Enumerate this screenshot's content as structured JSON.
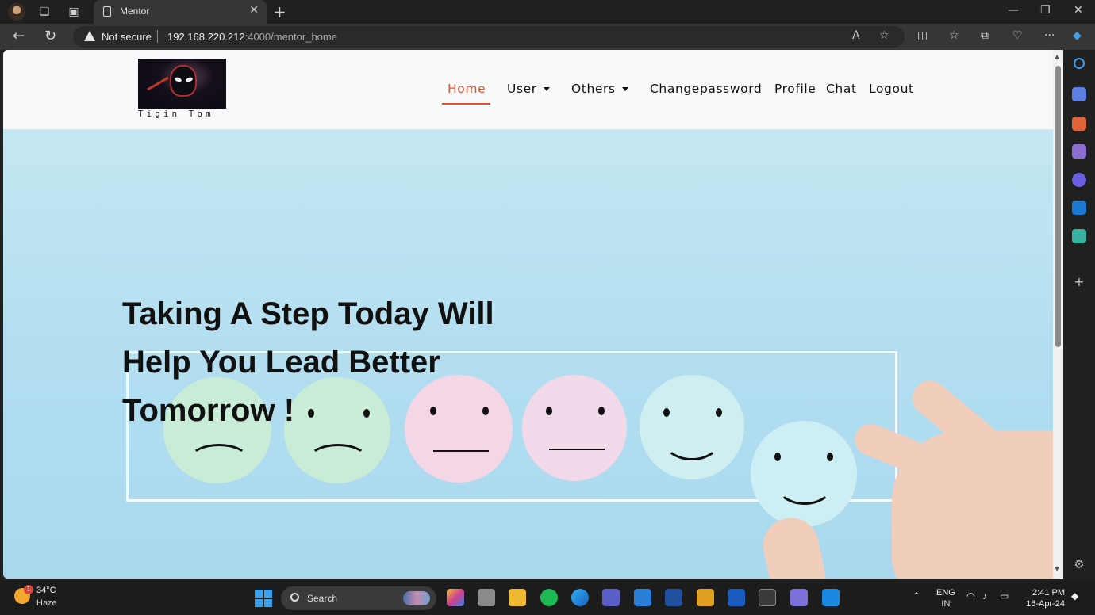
{
  "browser": {
    "tab_title": "Mentor",
    "security_label": "Not secure",
    "url_host": "192.168.220.212",
    "url_rest": ":4000/mentor_home"
  },
  "site": {
    "brand_name": "Tigin Tom",
    "nav": {
      "home": "Home",
      "user": "User",
      "others": "Others",
      "changepassword": "Changepassword",
      "profile": "Profile",
      "chat": "Chat",
      "logout": "Logout"
    },
    "hero": {
      "line1": "Taking A Step Today Will",
      "line2": "Help You Lead Better",
      "line3": "Tomorrow !"
    }
  },
  "taskbar": {
    "badge_count": "1",
    "temperature": "34°C",
    "weather": "Haze",
    "search_label": "Search",
    "lang_line1": "ENG",
    "lang_line2": "IN",
    "time": "2:41 PM",
    "date": "16-Apr-24"
  },
  "colors": {
    "accent": "#e5532d",
    "hero_bg": "#b3def0"
  }
}
